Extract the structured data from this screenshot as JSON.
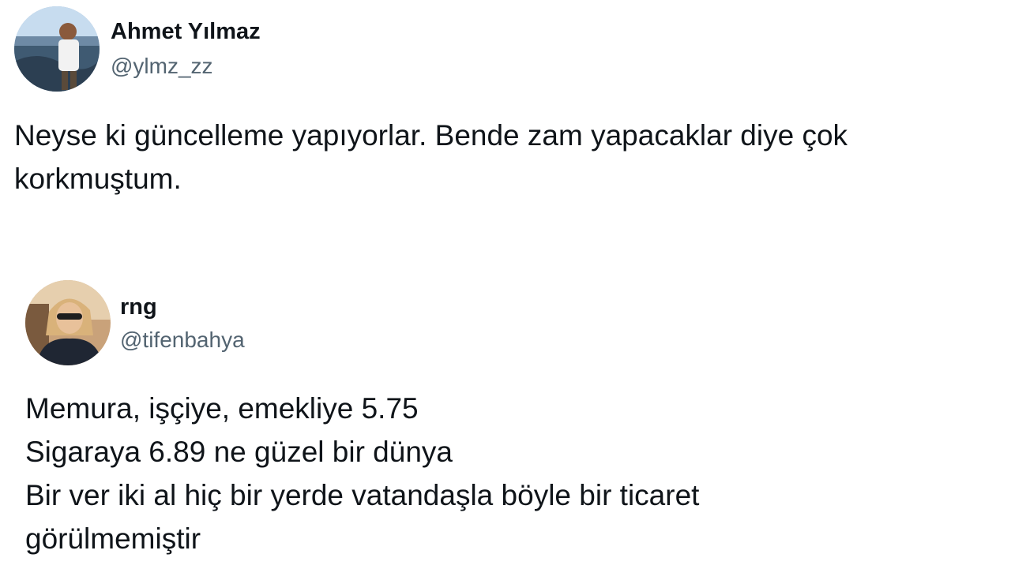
{
  "tweets": [
    {
      "display_name": "Ahmet Yılmaz",
      "handle": "@ylmz_zz",
      "text_lines": [
        "Neyse ki güncelleme yapıyorlar. Bende zam yapacaklar diye çok",
        "korkmuştum."
      ]
    },
    {
      "display_name": "rng",
      "handle": "@tifenbahya",
      "text_lines": [
        "Memura, işçiye, emekliye 5.75",
        "Sigaraya 6.89 ne güzel bir dünya",
        "Bir ver iki al hiç bir yerde vatandaşla böyle bir ticaret",
        "görülmemiştir"
      ]
    }
  ],
  "colors": {
    "background": "#ffffff",
    "text_primary": "#0f1419",
    "text_secondary": "#536471"
  }
}
